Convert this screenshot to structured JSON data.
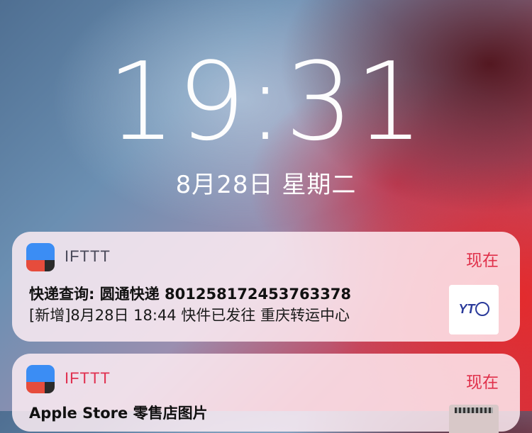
{
  "lockscreen": {
    "time": "19:31",
    "date": "8月28日 星期二"
  },
  "notifications": [
    {
      "app": "IFTTT",
      "time": "现在",
      "title": "快递查询: 圆通快递 801258172453763378",
      "body": "[新增]8月28日 18:44 快件已发往 重庆转运中心",
      "thumbnail_label": "YTO"
    },
    {
      "app": "IFTTT",
      "time": "现在",
      "title": "Apple Store 零售店图片"
    }
  ],
  "colors": {
    "accent_red": "#e0304a",
    "ifttt_blue": "#3b8df4",
    "ifttt_red": "#e64c3c",
    "ifttt_dark": "#2b2b2b"
  }
}
